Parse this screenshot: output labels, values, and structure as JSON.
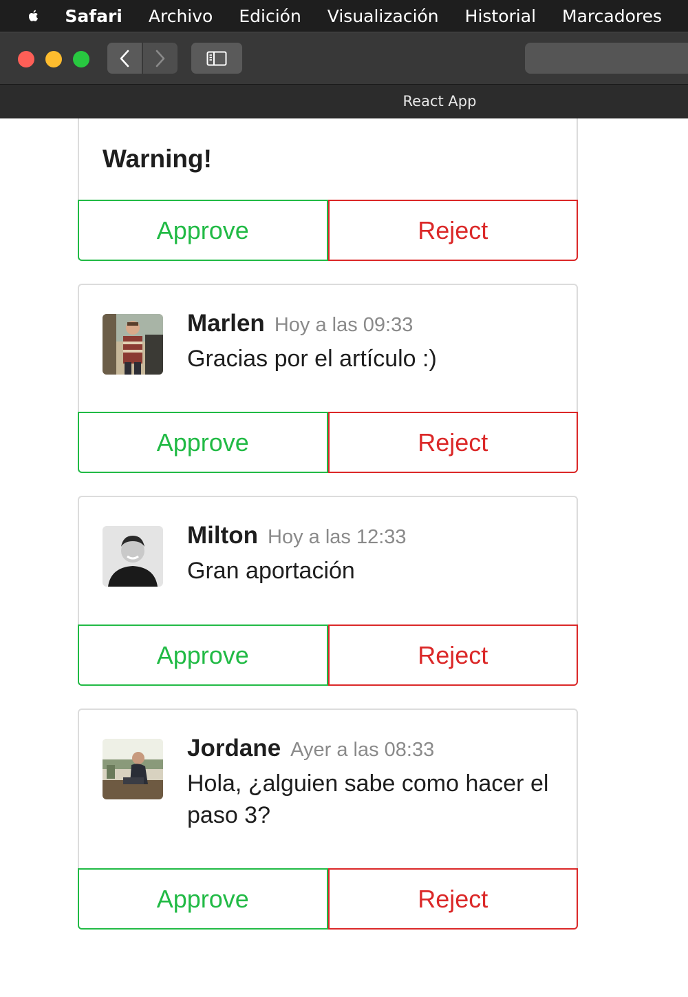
{
  "menubar": {
    "app_name": "Safari",
    "items": [
      "Archivo",
      "Edición",
      "Visualización",
      "Historial",
      "Marcadores"
    ]
  },
  "browser": {
    "tab_title": "React App"
  },
  "warning_card": {
    "title": "Warning!",
    "approve_label": "Approve",
    "reject_label": "Reject"
  },
  "comments": [
    {
      "author": "Marlen",
      "date": "Hoy a las 09:33",
      "text": "Gracias por el artículo :)",
      "approve_label": "Approve",
      "reject_label": "Reject"
    },
    {
      "author": "Milton",
      "date": "Hoy a las 12:33",
      "text": "Gran aportación",
      "approve_label": "Approve",
      "reject_label": "Reject"
    },
    {
      "author": "Jordane",
      "date": "Ayer a las 08:33",
      "text": "Hola, ¿alguien sabe como hacer el paso 3?",
      "approve_label": "Approve",
      "reject_label": "Reject"
    }
  ],
  "colors": {
    "approve": "#21ba45",
    "reject": "#db2828",
    "card_border": "#dcdcdc"
  }
}
